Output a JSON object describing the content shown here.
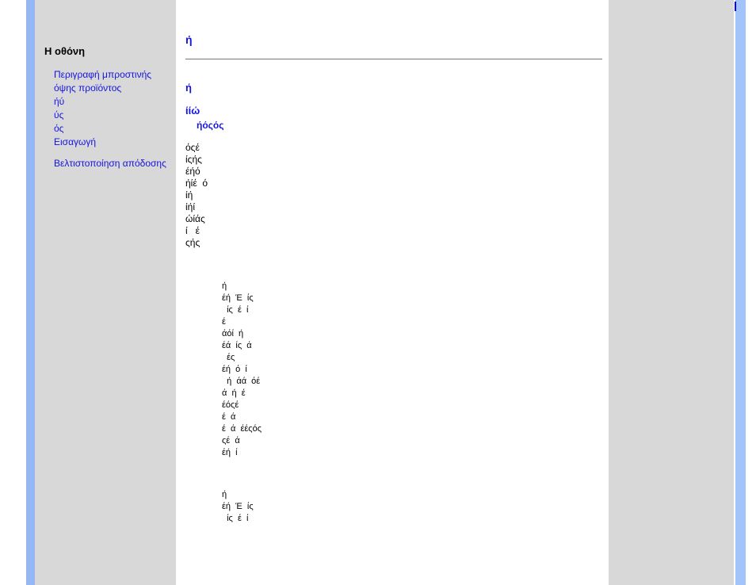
{
  "sidebar": {
    "title": "Η οθόνη",
    "links": [
      {
        "label": "Περιγραφή μπροστινής όψης προϊόντος",
        "two": true
      },
      {
        "label": "ήύ"
      },
      {
        "label": "ύς"
      },
      {
        "label": "ός"
      },
      {
        "label": "Εισαγωγή"
      },
      {
        "gap": true
      },
      {
        "label": "Βελτιστοποίηση απόδοσης"
      }
    ]
  },
  "main": {
    "title": "ή",
    "sub1": "ή",
    "sub2": "ίίώ",
    "sub3": "ήόςός",
    "paragraph1": [
      "όςέ",
      "ίςής",
      "έήό",
      "ήίέ  ό",
      "ίή",
      "ίήί",
      "ώίάς",
      "ί   έ",
      "ςής"
    ],
    "block2": [
      "ή",
      "έή  Έ  ίς",
      "  ίς  έ  ί",
      "έ",
      "άόί  ή",
      "έά  ίς  ά",
      "  ές",
      "έή  ό  ί",
      "  ή  άά  όέ",
      "ά  ή  έ",
      "έόςέ",
      "έ  ά",
      "έ  ά  έέςός",
      "ςέ  ά",
      "έή  ί"
    ],
    "block3": [
      "ή",
      "έή  Έ  ίς",
      "  ίς  έ  ί"
    ]
  }
}
